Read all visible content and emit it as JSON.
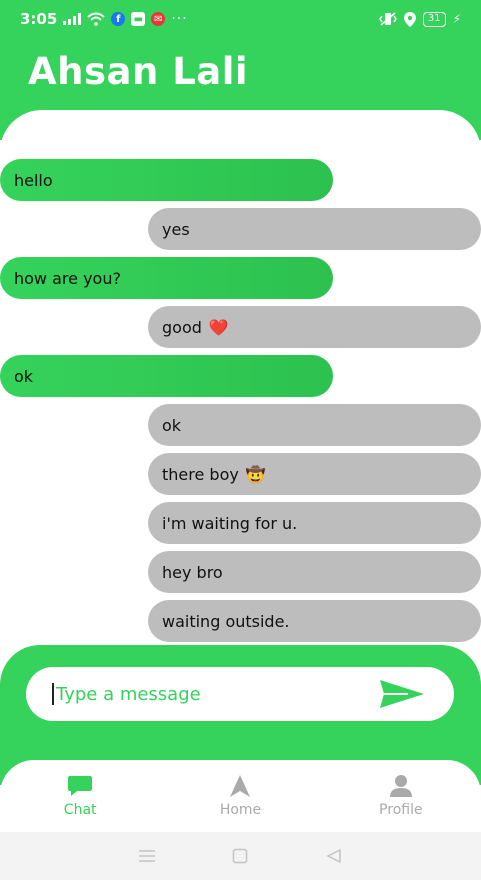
{
  "status_bar": {
    "time": "3:05",
    "battery": "31"
  },
  "header": {
    "title": "Ahsan Lali"
  },
  "messages": [
    {
      "text": "hello",
      "type": "sent"
    },
    {
      "text": "yes",
      "type": "received"
    },
    {
      "text": "how are you?",
      "type": "sent"
    },
    {
      "text": "good",
      "emoji": "❤️",
      "type": "received"
    },
    {
      "text": "ok",
      "type": "sent"
    },
    {
      "text": "ok",
      "type": "received"
    },
    {
      "text": "there boy",
      "emoji": "🤠",
      "type": "received"
    },
    {
      "text": "i'm waiting for u.",
      "type": "received"
    },
    {
      "text": "hey bro",
      "type": "received"
    },
    {
      "text": "waiting outside.",
      "type": "received"
    }
  ],
  "composer": {
    "placeholder": "Type a message"
  },
  "bottom_nav": {
    "items": [
      {
        "label": "Chat",
        "icon": "chat-icon",
        "active": true
      },
      {
        "label": "Home",
        "icon": "navigation-arrow-icon",
        "active": false
      },
      {
        "label": "Profile",
        "icon": "person-icon",
        "active": false
      }
    ]
  },
  "colors": {
    "brand_green": "#35d35b",
    "received_bubble": "#bdbdbd"
  }
}
